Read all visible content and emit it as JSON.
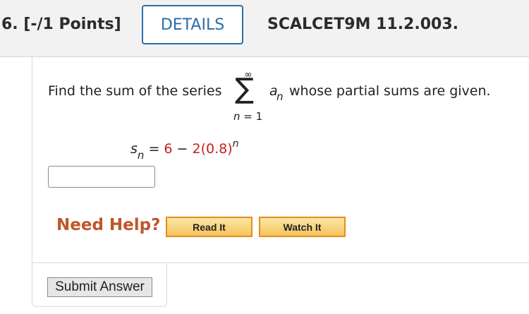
{
  "header": {
    "question_number": "6. [-/1 Points]",
    "details_label": "DETAILS",
    "question_code": "SCALCET9M 11.2.003."
  },
  "problem": {
    "prompt_before": "Find the sum of the series",
    "sigma_symbol": "∑",
    "sigma_upper": "∞",
    "sigma_lower_var": "n",
    "sigma_lower_rest": " = 1",
    "term_var": "a",
    "term_sub": "n",
    "prompt_after": "whose partial sums are given.",
    "partial_sum_var": "s",
    "partial_sum_sub": "n",
    "equals": " = ",
    "expr_a": "6",
    "minus": " − ",
    "expr_b": "2(0.8)",
    "exponent": "n"
  },
  "answer": {
    "value": ""
  },
  "help": {
    "label": "Need Help?",
    "read_label": "Read It",
    "watch_label": "Watch It"
  },
  "submit": {
    "label": "Submit Answer"
  },
  "colors": {
    "details_border": "#2d6ea5",
    "need_help": "#c0562b",
    "expression_red": "#c81e1e",
    "help_button_border": "#e88c1a"
  }
}
